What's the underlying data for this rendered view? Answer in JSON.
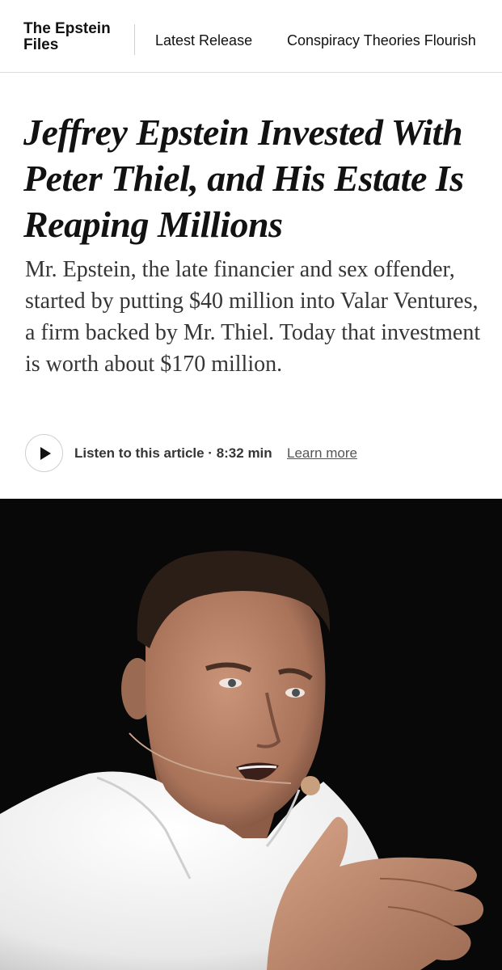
{
  "header": {
    "section_name": "The Epstein Files",
    "nav_links": [
      "Latest Release",
      "Conspiracy Theories Flourish"
    ]
  },
  "article": {
    "headline": "Jeffrey Epstein Invested With Peter Thiel, and His Estate Is Reaping Millions",
    "summary": "Mr. Epstein, the late financier and sex offender, started by putting $40 million into Valar Ventures, a firm backed by Mr. Thiel. Today that investment is worth about $170 million."
  },
  "audio": {
    "listen_text": "Listen to this article · 8:32 min",
    "learn_more": "Learn more"
  },
  "image": {
    "subject_icon": "portrait-photo",
    "colors": {
      "background": "#0a0a0a",
      "shirt": "#f2f2f2",
      "skin": "#b9856b"
    }
  }
}
